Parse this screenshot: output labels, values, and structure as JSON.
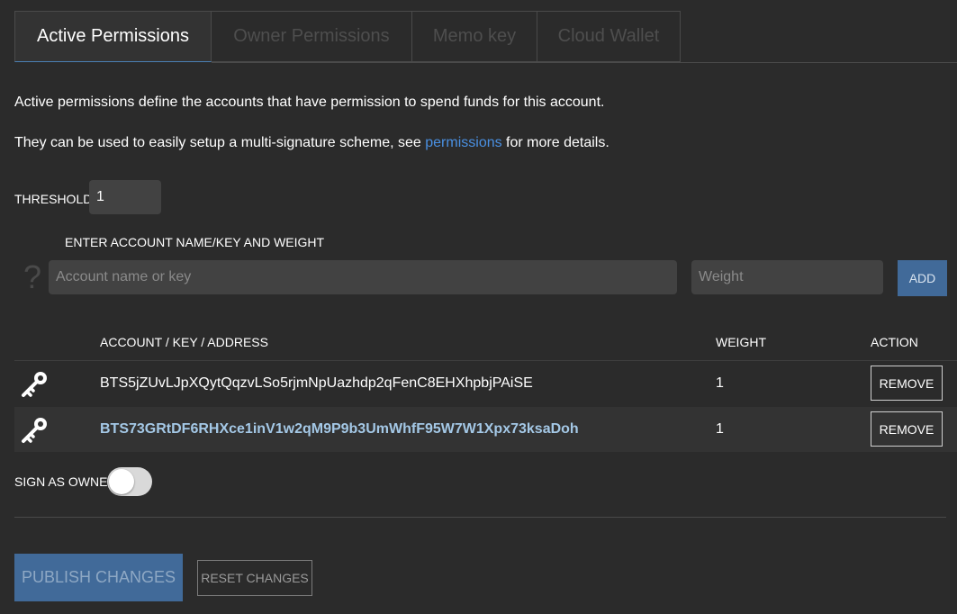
{
  "tabs": [
    {
      "label": "Active Permissions",
      "active": true
    },
    {
      "label": "Owner Permissions",
      "active": false
    },
    {
      "label": "Memo key",
      "active": false
    },
    {
      "label": "Cloud Wallet",
      "active": false
    }
  ],
  "description": {
    "line1": "Active permissions define the accounts that have permission to spend funds for this account.",
    "line2_prefix": "They can be used to easily setup a multi-signature scheme, see ",
    "line2_link": "permissions",
    "line2_suffix": " for more details."
  },
  "threshold": {
    "label": "THRESHOLD",
    "value": "1"
  },
  "add_form": {
    "label": "ENTER ACCOUNT NAME/KEY AND WEIGHT",
    "help_icon": "question-mark-icon",
    "account_placeholder": "Account name or key",
    "account_value": "",
    "weight_placeholder": "Weight",
    "weight_value": "",
    "add_label": "ADD"
  },
  "table": {
    "headers": {
      "account": "ACCOUNT / KEY / ADDRESS",
      "weight": "WEIGHT",
      "action": "ACTION"
    },
    "rows": [
      {
        "icon": "key-icon",
        "account": "BTS5jZUvLJpXQytQqzvLSo5rjmNpUazhdp2qFenC8EHXhpbjPAiSE",
        "weight": "1",
        "action_label": "REMOVE",
        "highlight": false
      },
      {
        "icon": "key-icon",
        "account": "BTS73GRtDF6RHXce1inV1w2qM9P9b3UmWhfF95W7W1Xpx73ksaDoh",
        "weight": "1",
        "action_label": "REMOVE",
        "highlight": true
      }
    ]
  },
  "sign_as_owner": {
    "label": "SIGN AS OWNER:",
    "enabled": false
  },
  "actions": {
    "publish_label": "PUBLISH CHANGES",
    "reset_label": "RESET CHANGES"
  },
  "colors": {
    "background": "#2b2b2b",
    "accent": "#416a99",
    "link": "#4a90e2",
    "highlight_text": "#a4c8e6"
  }
}
